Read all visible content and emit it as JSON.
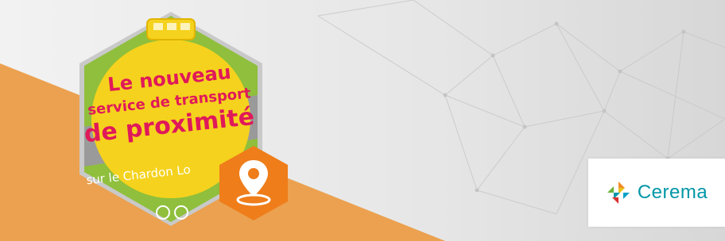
{
  "badge": {
    "line1": "Le nouveau",
    "line2": "service de transport",
    "line3": "de proximité",
    "line4": "sur le Chardon Lo"
  },
  "logo": {
    "name": "Cerema",
    "color": "#0097a7"
  },
  "colors": {
    "orange": "#eba14f",
    "pink": "#e0195a",
    "yellow": "#f5d21d",
    "pin_orange": "#ef7d1a"
  },
  "icons": [
    "location-pin-icon",
    "cerema-logo-icon"
  ]
}
